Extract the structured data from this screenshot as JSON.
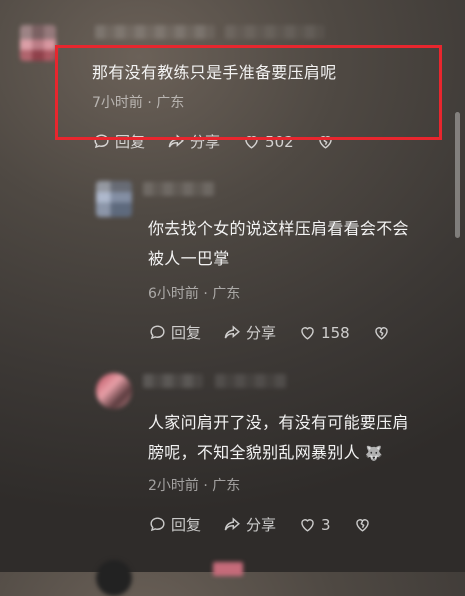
{
  "comment1": {
    "text": "那有没有教练只是手准备要压肩呢",
    "time": "7小时前",
    "location": "广东",
    "reply_label": "回复",
    "share_label": "分享",
    "like_count": "502"
  },
  "comment2": {
    "line1": "你去找个女的说这样压肩看看会不会",
    "line2": "被人一巴掌",
    "time": "6小时前",
    "location": "广东",
    "reply_label": "回复",
    "share_label": "分享",
    "like_count": "158"
  },
  "comment3": {
    "line1": "人家问肩开了没，有没有可能要压肩",
    "line2": "膀呢，不知全貌别乱网暴别人",
    "emoji": "🐺",
    "time": "2小时前",
    "location": "广东",
    "reply_label": "回复",
    "share_label": "分享",
    "like_count": "3"
  },
  "separator": "·",
  "colors": {
    "highlight": "#e8262e",
    "text": "#f3f3f3",
    "muted": "rgba(255,255,255,.55)"
  }
}
